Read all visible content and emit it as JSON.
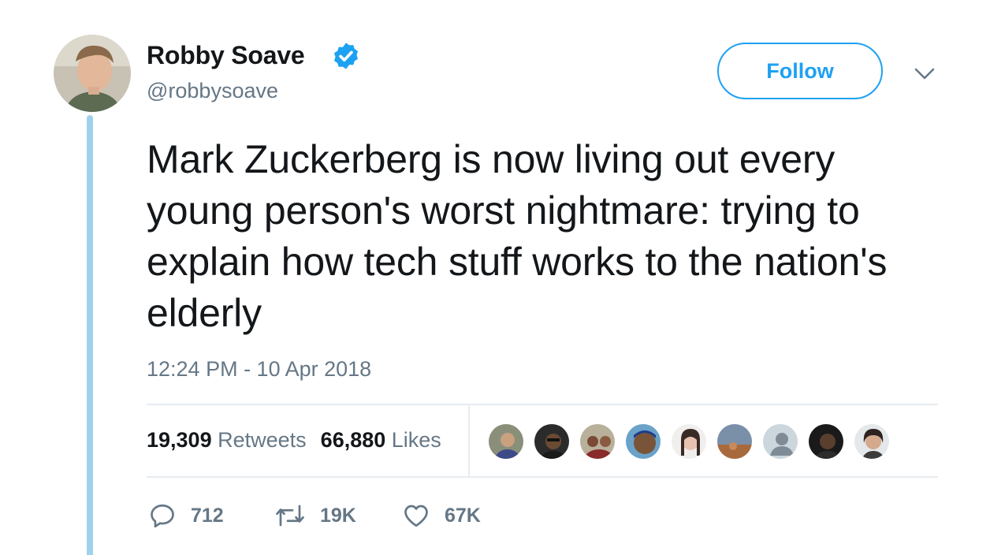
{
  "user": {
    "name": "Robby Soave",
    "handle": "@robbysoave",
    "verified": true
  },
  "follow_button": {
    "label": "Follow"
  },
  "tweet": {
    "text": "Mark Zuckerberg is now living out every young person's worst nightmare: trying to explain how tech stuff works to the nation's elderly",
    "timestamp": "12:24 PM - 10 Apr 2018"
  },
  "stats": {
    "retweets_count": "19,309",
    "retweets_label": "Retweets",
    "likes_count": "66,880",
    "likes_label": "Likes"
  },
  "liker_avatars": 9,
  "actions": {
    "reply_count": "712",
    "retweet_count": "19K",
    "like_count": "67K"
  },
  "colors": {
    "accent": "#1da1f2",
    "muted": "#657786",
    "text": "#14171a",
    "thread_line": "#9fd2ea",
    "divider": "#e6ecf0"
  },
  "icons": [
    "verified-badge-icon",
    "chevron-down-icon",
    "reply-icon",
    "retweet-icon",
    "heart-icon"
  ]
}
